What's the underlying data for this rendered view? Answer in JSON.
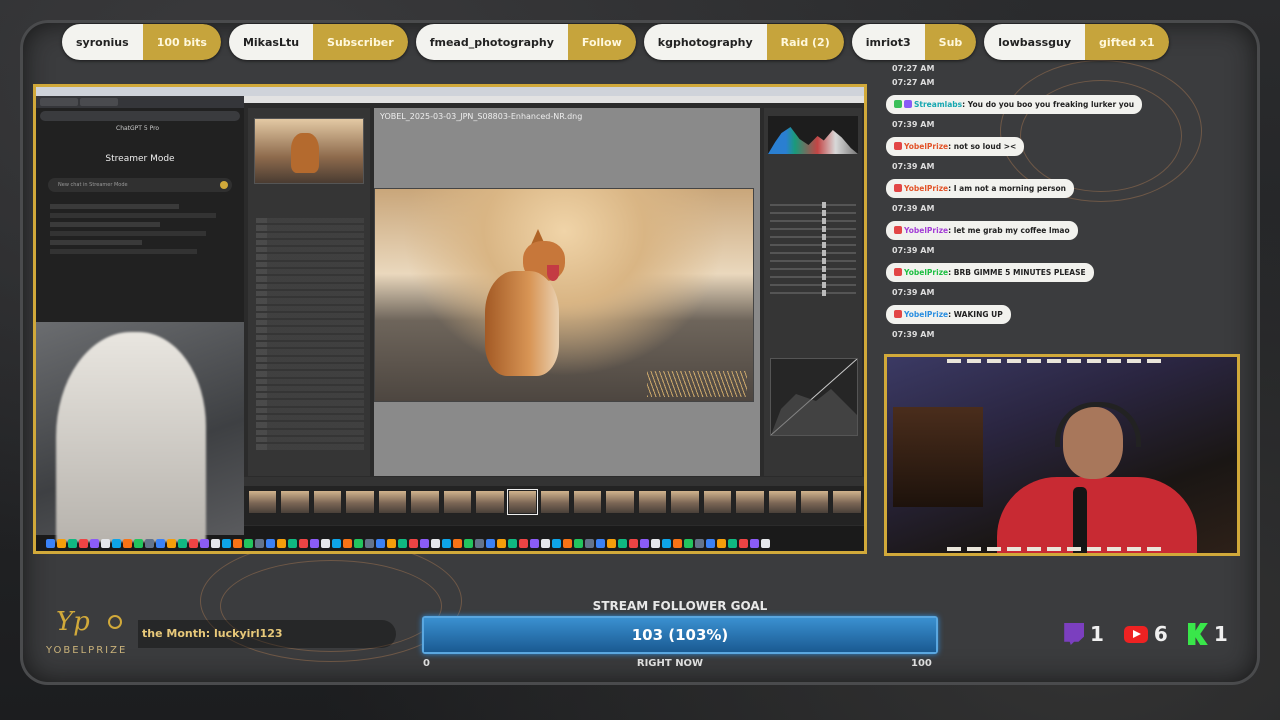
{
  "alerts": [
    {
      "user": "syronius",
      "event": "100 bits"
    },
    {
      "user": "MikasLtu",
      "event": "Subscriber"
    },
    {
      "user": "fmead_photography",
      "event": "Follow"
    },
    {
      "user": "kgphotography",
      "event": "Raid (2)"
    },
    {
      "user": "imriot3",
      "event": "Sub"
    },
    {
      "user": "lowbassguy",
      "event": "gifted x1"
    }
  ],
  "screen": {
    "chatgpt": {
      "title": "ChatGPT 5 Pro",
      "mode": "Streamer Mode",
      "input_placeholder": "New chat in Streamer Mode"
    },
    "lightroom": {
      "file_name": "YOBEL_2025-03-03_JPN_S08803-Enhanced-NR.dng"
    }
  },
  "chat": {
    "messages": [
      {
        "time": "07:27 AM",
        "user": "",
        "text": ""
      },
      {
        "time": "07:27 AM",
        "user": "Streamlabs",
        "text": ": You do you boo you freaking lurker you"
      },
      {
        "time": "07:39 AM",
        "user": "YobelPrize",
        "text": ": not so loud ><"
      },
      {
        "time": "07:39 AM",
        "user": "YobelPrize",
        "text": ": I am not a morning person"
      },
      {
        "time": "07:39 AM",
        "user": "YobelPrize",
        "text": ": let me grab my coffee lmao"
      },
      {
        "time": "07:39 AM",
        "user": "YobelPrize",
        "text": ": BRB GIMME 5 MINUTES PLEASE"
      },
      {
        "time": "07:39 AM",
        "user": "YobelPrize",
        "text": ": WAKING UP"
      }
    ]
  },
  "branding": {
    "logo_text": "YOBELPRIZE",
    "ticker": "the Month: luckyirl123"
  },
  "goal": {
    "title": "STREAM FOLLOWER GOAL",
    "value_label": "103 (103%)",
    "progress_fraction": 1.0,
    "min": "0",
    "max": "100",
    "subtitle": "RIGHT NOW"
  },
  "platforms": [
    {
      "name": "twitch-icon",
      "count": "1",
      "color": "#7b3fbf"
    },
    {
      "name": "youtube-icon",
      "count": "6",
      "color": "#e22222"
    },
    {
      "name": "kick-icon",
      "count": "1",
      "color": "#39e64a"
    }
  ],
  "colors": {
    "accent_gold": "#d1a93a",
    "goal_blue": "#1b6aa8"
  }
}
